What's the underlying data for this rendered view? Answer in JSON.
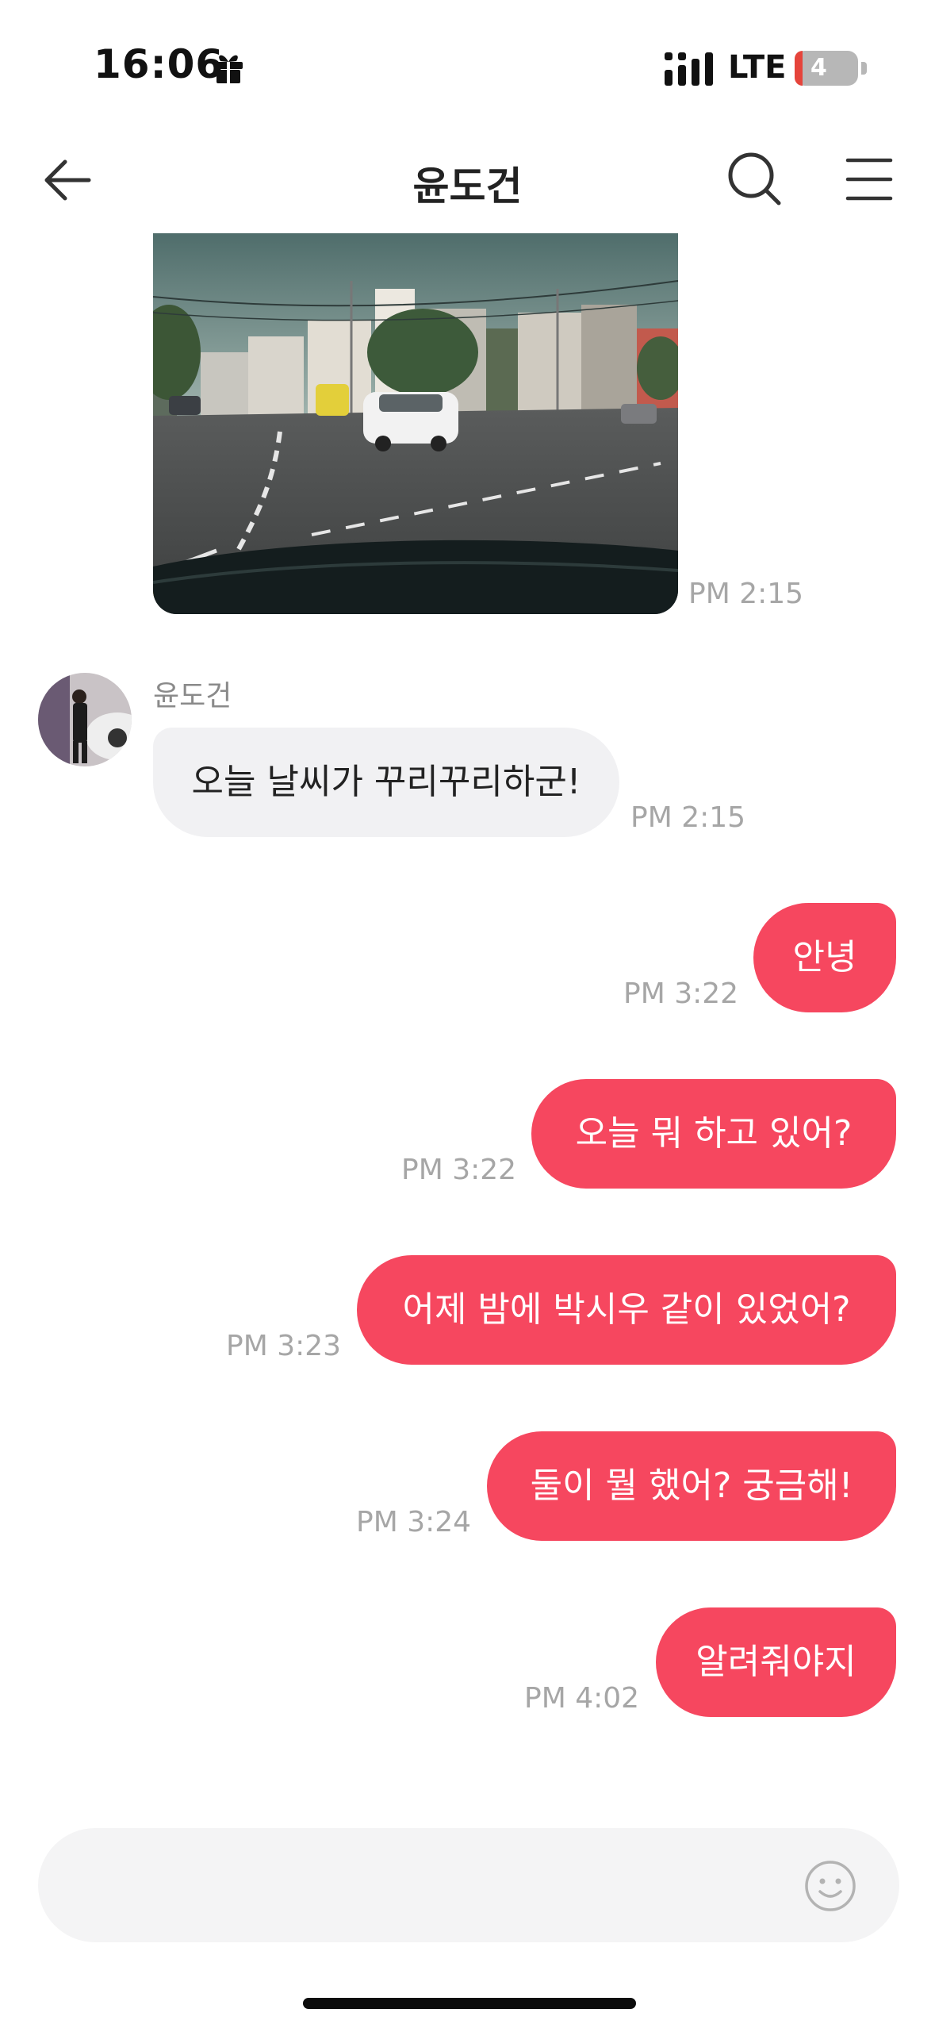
{
  "status_bar": {
    "time": "16:06",
    "network": "LTE",
    "battery_level": "4",
    "icons": [
      "gift-icon",
      "signal-icon",
      "battery-icon"
    ]
  },
  "header": {
    "title": "윤도건",
    "icons": [
      "back-arrow-icon",
      "search-icon",
      "menu-icon"
    ]
  },
  "messages": [
    {
      "type": "image",
      "direction": "received",
      "time": "PM 2:15",
      "image": "street-intersection-photo"
    },
    {
      "type": "text",
      "direction": "received",
      "sender": "윤도건",
      "text": "오늘 날씨가 꾸리꾸리하군!",
      "time": "PM 2:15"
    },
    {
      "type": "text",
      "direction": "sent",
      "text": "안녕",
      "time": "PM 3:22"
    },
    {
      "type": "text",
      "direction": "sent",
      "text": "오늘 뭐 하고 있어?",
      "time": "PM 3:22"
    },
    {
      "type": "text",
      "direction": "sent",
      "text": "어제 밤에 박시우 같이 있었어?",
      "time": "PM 3:23"
    },
    {
      "type": "text",
      "direction": "sent",
      "text": "둘이 뭘 했어? 궁금해!",
      "time": "PM 3:24"
    },
    {
      "type": "text",
      "direction": "sent",
      "text": "알려줘야지",
      "time": "PM 4:02"
    }
  ],
  "input": {
    "value": "",
    "placeholder": "",
    "icon": "emoji-icon"
  },
  "colors": {
    "sent_bubble": "#f6475f",
    "received_bubble": "#f1f1f3",
    "timestamp": "#a6a6a6"
  }
}
